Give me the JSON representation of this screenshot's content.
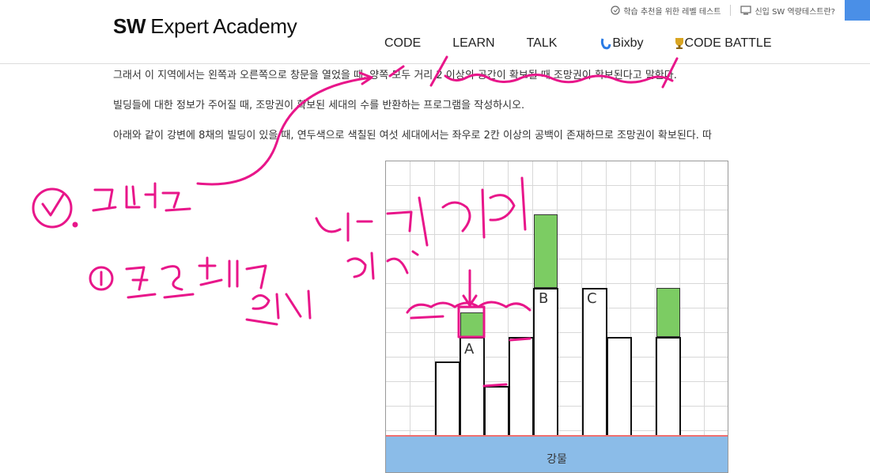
{
  "util": {
    "item1": "학습 추천을 위한 레벨 테스트",
    "item2": "신입 SW 역량테스트란?"
  },
  "header": {
    "logo_bold": "SW",
    "logo_rest": "Expert Academy"
  },
  "nav": [
    "CODE",
    "LEARN",
    "TALK",
    "Bixby",
    "CODE BATTLE"
  ],
  "problem": {
    "line1": "그래서 이 지역에서는 왼쪽과 오른쪽으로 창문을 열었을 때, 양쪽 모두 거리 2 이상의 공간이 확보될 때 조망권이 확보된다고 말한다.",
    "line2": "빌딩들에 대한 정보가 주어질 때, 조망권이 확보된 세대의 수를 반환하는 프로그램을 작성하시오.",
    "line3": "아래와 같이 강변에 8채의 빌딩이 있을 때, 연두색으로 색칠된 여섯 세대에서는 좌우로 2칸 이상의 공백이 존재하므로 조망권이 확보된다. 따"
  },
  "figure": {
    "label_a": "A",
    "label_b": "B",
    "label_c": "C",
    "river_label": "강물",
    "colors": {
      "green": "#7ccc63",
      "river": "#8bbce8",
      "river_edge": "#f07070"
    }
  },
  "icons": [
    "book-icon",
    "monitor-icon",
    "bixby-icon",
    "trophy-icon"
  ]
}
